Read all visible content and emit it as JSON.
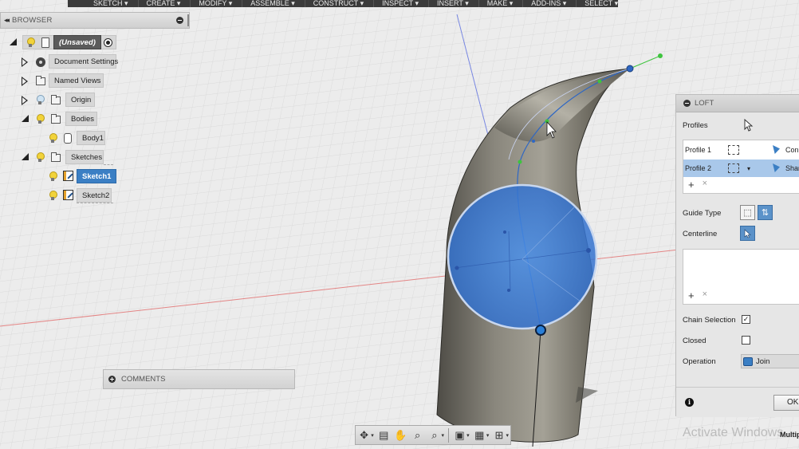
{
  "toolbar": {
    "items": [
      "SKETCH ▾",
      "CREATE ▾",
      "MODIFY ▾",
      "ASSEMBLE ▾",
      "CONSTRUCT ▾",
      "INSPECT ▾",
      "INSERT ▾",
      "MAKE ▾",
      "ADD-INS ▾",
      "SELECT ▾"
    ]
  },
  "browser": {
    "chevron": "◂◂",
    "title": "BROWSER",
    "root_label": "(Unsaved)",
    "items": {
      "document_settings": "Document Settings",
      "named_views": "Named Views",
      "origin": "Origin",
      "bodies": "Bodies",
      "body1": "Body1",
      "sketches": "Sketches",
      "sketch1": "Sketch1",
      "sketch2": "Sketch2"
    }
  },
  "comments": {
    "label": "COMMENTS"
  },
  "loft": {
    "title": "LOFT",
    "profiles_label": "Profiles",
    "profiles": [
      {
        "name": "Profile 1",
        "type": "Conn"
      },
      {
        "name": "Profile 2",
        "type": "Shar"
      }
    ],
    "guide_type_label": "Guide Type",
    "centerline_label": "Centerline",
    "chain_selection_label": "Chain Selection",
    "chain_selection_mark": "✓",
    "closed_label": "Closed",
    "operation_label": "Operation",
    "operation_value": "Join",
    "ok_label": "OK",
    "plus": "+",
    "x": "×",
    "caret": "▾",
    "info": "i"
  },
  "nav_toolbar": {
    "orbit": "✥",
    "look": "▤",
    "pan": "✋",
    "zoom": "⌕",
    "fit": "⌕",
    "display": "▣",
    "grid": "▦",
    "viewports": "⊞",
    "caret": "▾"
  },
  "watermark": "Activate Windows",
  "status_text": "Multip",
  "colors": {
    "selection_blue": "#3b7fc4",
    "profile_face_blue": "#3c7fe0",
    "viewport_bg": "#ececec",
    "model_body": "#6f6c63"
  }
}
